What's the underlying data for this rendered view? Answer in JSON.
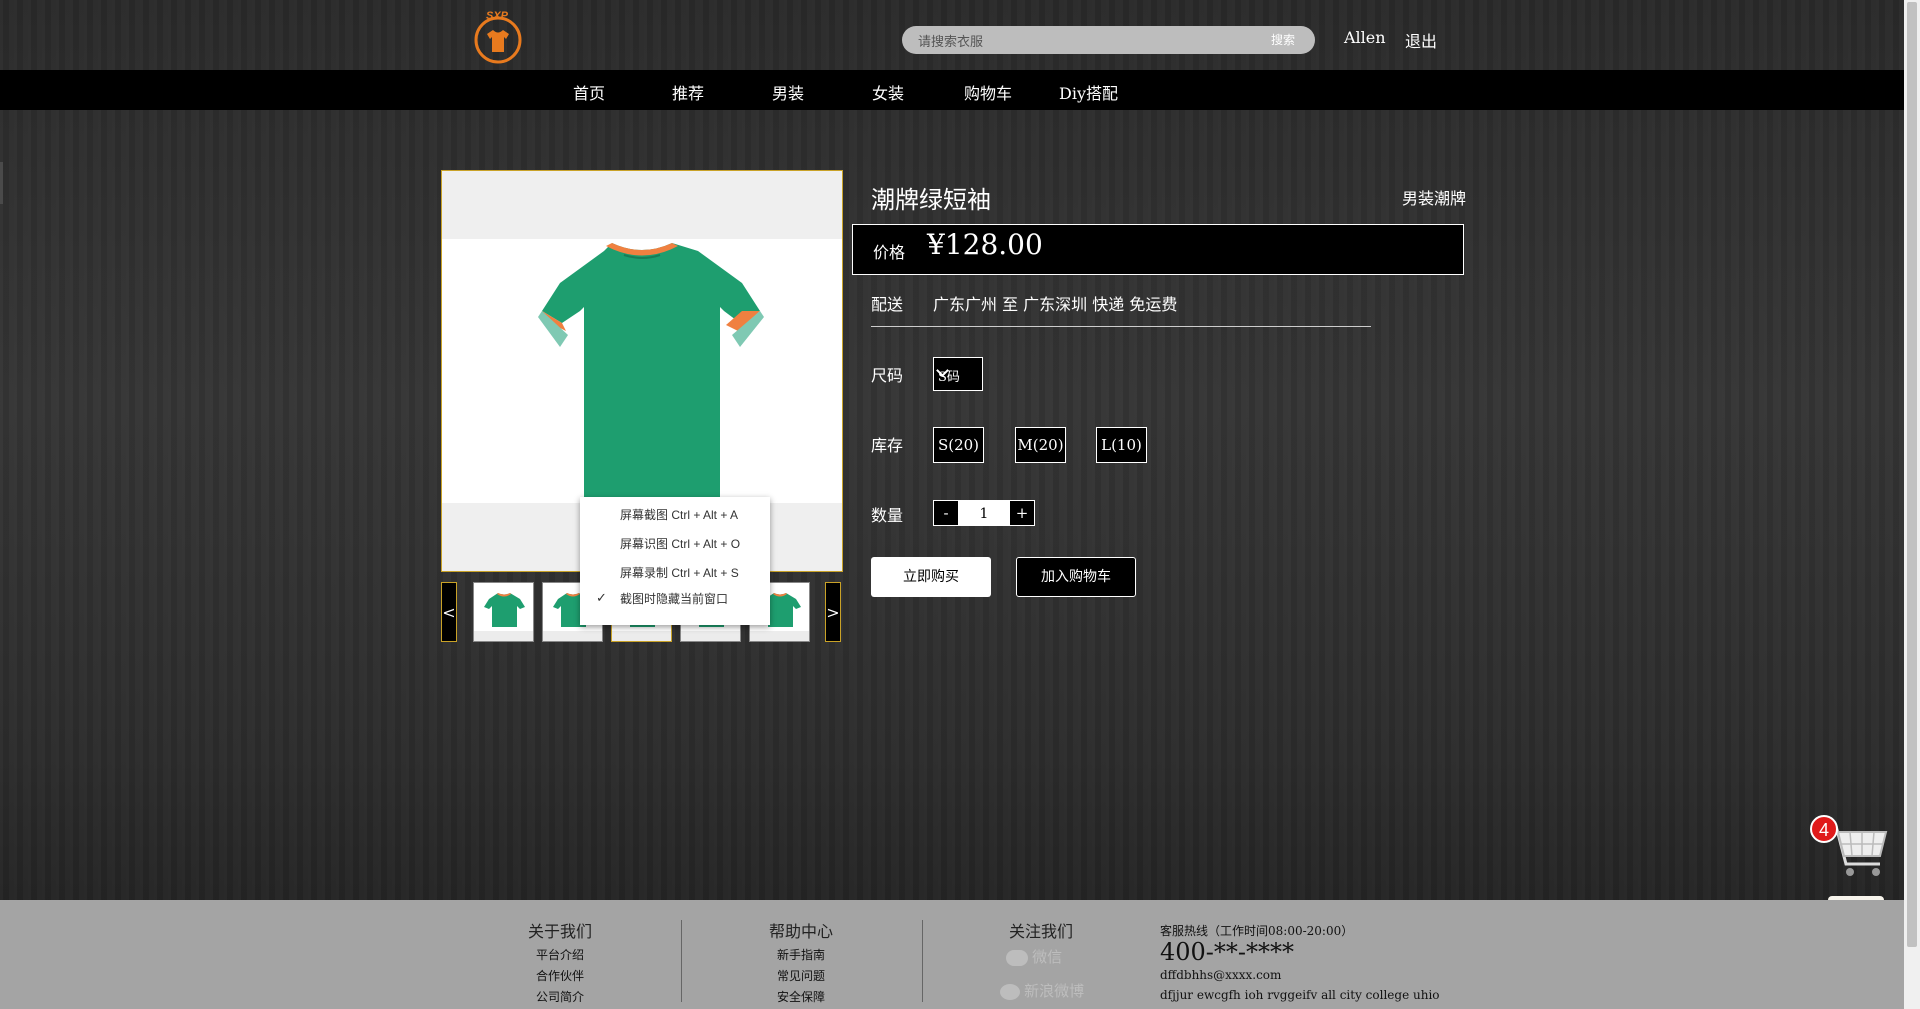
{
  "header": {
    "logo_text": "SXP",
    "search_placeholder": "请搜索衣服",
    "search_button": "搜索",
    "username": "Allen",
    "logout": "退出"
  },
  "nav": {
    "items": [
      "首页",
      "推荐",
      "男装",
      "女装",
      "购物车",
      "Diy搭配"
    ]
  },
  "product": {
    "title": "潮牌绿短袖",
    "brand": "男装潮牌",
    "price_label": "价格",
    "price": "¥128.00",
    "shipping_label": "配送",
    "shipping": "广东广州 至 广东深圳 快递 免运费",
    "size_label": "尺码",
    "size_selected": "S码",
    "stock_label": "库存",
    "stock": [
      "S(20)",
      "M(20)",
      "L(10)"
    ],
    "qty_label": "数量",
    "qty_minus": "-",
    "qty_value": "1",
    "qty_plus": "+",
    "buy_now": "立即购买",
    "add_to_cart": "加入购物车",
    "shirt_color": "#1e9e6f",
    "collar_color": "#f08040"
  },
  "gallery": {
    "prev": "<",
    "next": ">",
    "thumbnail_count": 5
  },
  "context_menu": {
    "items": [
      "屏幕截图 Ctrl + Alt + A",
      "屏幕识图 Ctrl + Alt + O",
      "屏幕录制 Ctrl + Alt + S",
      "截图时隐藏当前窗口"
    ],
    "checked_item": "截图时隐藏当前窗口"
  },
  "cart_float": {
    "badge_count": "4"
  },
  "footer": {
    "about": {
      "title": "关于我们",
      "links": [
        "平台介绍",
        "合作伙伴",
        "公司简介"
      ]
    },
    "help": {
      "title": "帮助中心",
      "links": [
        "新手指南",
        "常见问题",
        "安全保障"
      ]
    },
    "follow": {
      "title": "关注我们",
      "items": [
        "微信",
        "新浪微博"
      ]
    },
    "contact": {
      "hotline_label": "客服热线（工作时间08:00-20:00）",
      "phone": "400-**-****",
      "email": "dffdbhhs@xxxx.com",
      "address": "dfjjur ewcgfh ioh rvggeifv all city college uhio"
    }
  }
}
